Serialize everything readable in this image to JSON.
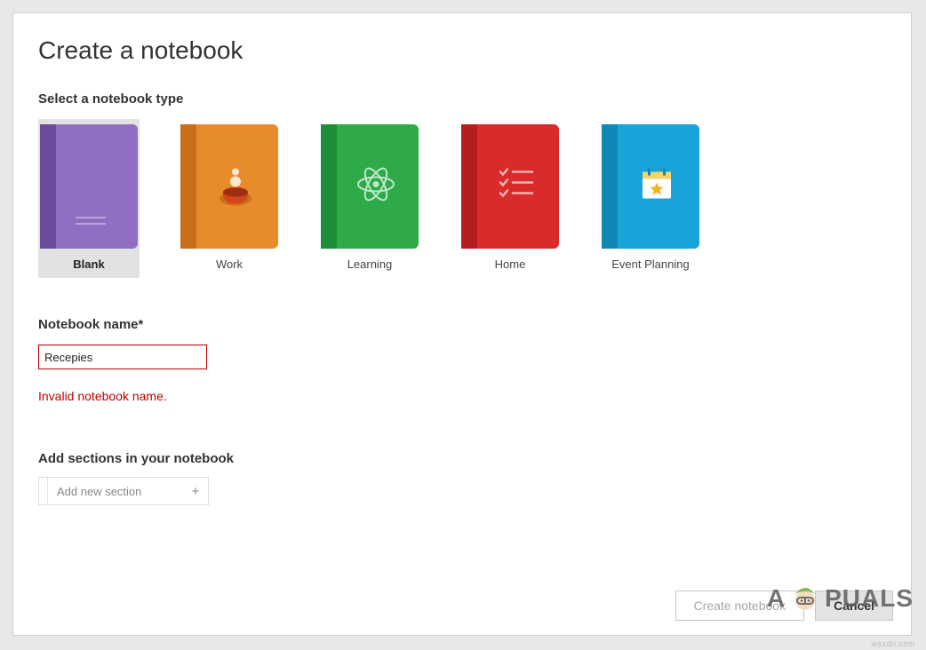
{
  "dialog": {
    "title": "Create a notebook",
    "types_label": "Select a notebook type",
    "types": [
      {
        "id": "blank",
        "label": "Blank",
        "color_key": "blank",
        "selected": true
      },
      {
        "id": "work",
        "label": "Work",
        "color_key": "work",
        "selected": false
      },
      {
        "id": "learn",
        "label": "Learning",
        "color_key": "learn",
        "selected": false
      },
      {
        "id": "home",
        "label": "Home",
        "color_key": "home",
        "selected": false
      },
      {
        "id": "event",
        "label": "Event Planning",
        "color_key": "event",
        "selected": false
      }
    ],
    "name_label": "Notebook name*",
    "name_value": "Recepies",
    "name_error": "Invalid notebook name.",
    "sections_label": "Add sections in your notebook",
    "add_section_label": "Add new section",
    "buttons": {
      "create": "Create notebook",
      "cancel": "Cancel"
    }
  },
  "watermark": {
    "left": "A",
    "right": "PUALS"
  },
  "credit": "wsxdn.com"
}
